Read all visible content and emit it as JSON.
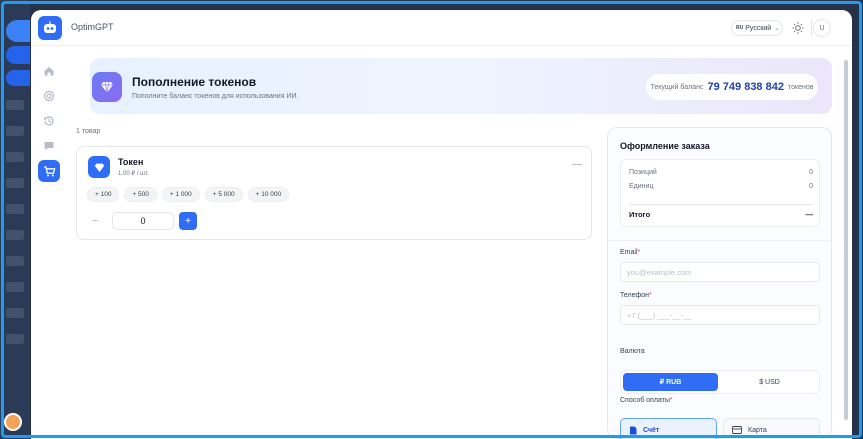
{
  "app": {
    "title": "OptimGPT"
  },
  "header": {
    "lang_code": "RU",
    "lang_label": "Русский",
    "user_initial": "U"
  },
  "banner": {
    "title": "Пополнение токенов",
    "subtitle": "Пополните баланс токенов для использования ИИ.",
    "balance_label": "Текущий баланс",
    "balance_value": "79 749 838 842",
    "balance_unit": "токенов"
  },
  "items": {
    "count_label": "1 товар",
    "product": {
      "name": "Токен",
      "price": "1.00 ₽ / шт.",
      "remove": "—",
      "chips": [
        "+ 100",
        "+ 500",
        "+ 1 000",
        "+ 5 000",
        "+ 10 000"
      ],
      "quantity": "0",
      "minus": "−",
      "plus": "+"
    }
  },
  "order": {
    "title": "Оформление заказа",
    "positions_label": "Позиций",
    "positions_value": "0",
    "units_label": "Единиц",
    "units_value": "0",
    "total_label": "Итого",
    "total_value": "—",
    "email_label": "Email",
    "email_placeholder": "you@example.com",
    "phone_label": "Телефон",
    "phone_placeholder": "+7 (___) ___-__-__",
    "currency_label": "Валюта",
    "currency_rub": "₽ RUB",
    "currency_usd": "$ USD",
    "payment_label": "Способ оплаты",
    "payment_invoice": "Счёт",
    "payment_card": "Карта",
    "required_mark": "*"
  },
  "colors": {
    "accent": "#2f6df6",
    "balance": "#1e40af",
    "required": "#ef4444"
  }
}
